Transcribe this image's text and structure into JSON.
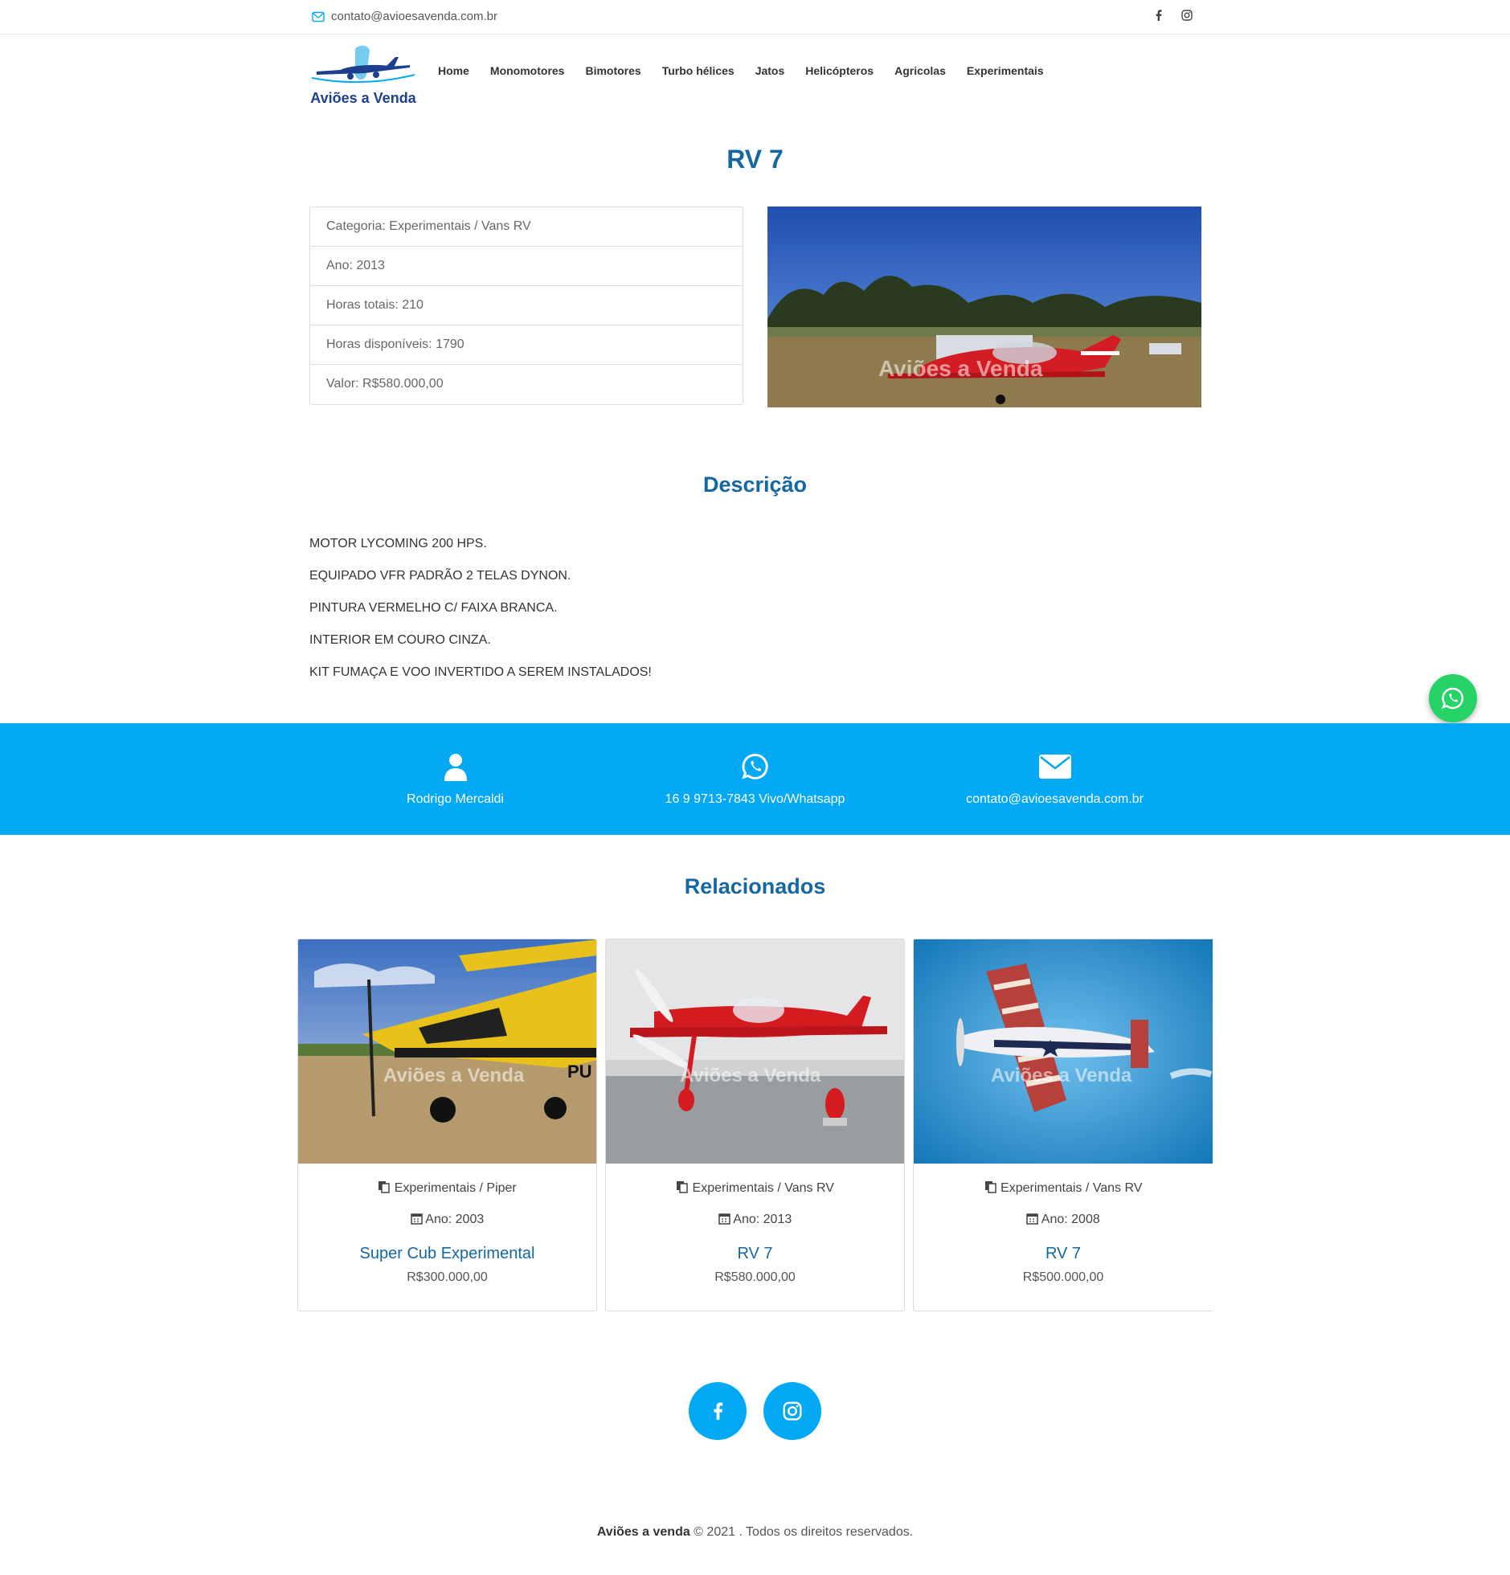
{
  "topbar": {
    "email": "contato@avioesavenda.com.br",
    "icons": [
      "mail-icon",
      "facebook-icon",
      "instagram-icon"
    ]
  },
  "header": {
    "logo_text": "Aviões a Venda",
    "nav": [
      "Home",
      "Monomotores",
      "Bimotores",
      "Turbo hélices",
      "Jatos",
      "Helicópteros",
      "Agricolas",
      "Experimentais"
    ]
  },
  "product": {
    "title": "RV 7",
    "specs": [
      "Categoria: Experimentais / Vans RV",
      "Ano: 2013",
      "Horas totais: 210",
      "Horas disponíveis: 1790",
      "Valor: R$580.000,00"
    ],
    "watermark": "Aviões a Venda"
  },
  "description": {
    "heading": "Descrição",
    "lines": [
      "MOTOR LYCOMING 200 HPS.",
      "EQUIPADO VFR PADRÃO 2 TELAS DYNON.",
      "PINTURA VERMELHO C/ FAIXA BRANCA.",
      "INTERIOR EM COURO CINZA.",
      "KIT FUMAÇA E VOO INVERTIDO A SEREM INSTALADOS!"
    ]
  },
  "contact": {
    "name": "Rodrigo Mercaldi",
    "phone": "16 9 9713-7843 Vivo/Whatsapp",
    "email": "contato@avioesavenda.com.br"
  },
  "related": {
    "heading": "Relacionados",
    "items": [
      {
        "category": "Experimentais / Piper",
        "year": "Ano: 2003",
        "name": "Super Cub Experimental",
        "price": "R$300.000,00"
      },
      {
        "category": "Experimentais / Vans RV",
        "year": "Ano: 2013",
        "name": "RV 7",
        "price": "R$580.000,00"
      },
      {
        "category": "Experimentais / Vans RV",
        "year": "Ano: 2008",
        "name": "RV 7",
        "price": "R$500.000,00"
      }
    ]
  },
  "footer": {
    "brand": "Aviões a venda",
    "rest": " © 2021 . Todos os direitos reservados."
  },
  "colors": {
    "accent": "#03a9f4",
    "title": "#1467a3",
    "whatsapp": "#25d366"
  }
}
